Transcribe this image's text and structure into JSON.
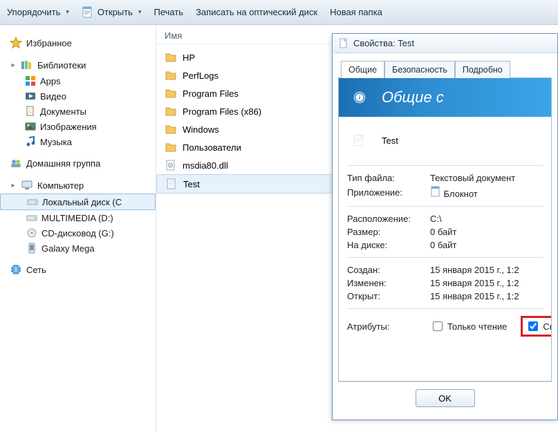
{
  "toolbar": {
    "organize": "Упорядочить",
    "open": "Открыть",
    "print": "Печать",
    "burn": "Записать на оптический диск",
    "newfolder": "Новая папка"
  },
  "sidebar": {
    "favorites": "Избранное",
    "libraries": "Библиотеки",
    "lib_items": [
      "Apps",
      "Видео",
      "Документы",
      "Изображения",
      "Музыка"
    ],
    "homegroup": "Домашняя группа",
    "computer": "Компьютер",
    "drives": [
      "Локальный диск (C",
      "MULTIMEDIA (D:)",
      "CD-дисковод (G:)",
      "Galaxy Mega"
    ],
    "network": "Сеть"
  },
  "filepane": {
    "header": "Имя",
    "items": [
      {
        "type": "folder",
        "name": "HP"
      },
      {
        "type": "folder",
        "name": "PerfLogs"
      },
      {
        "type": "folder",
        "name": "Program Files"
      },
      {
        "type": "folder",
        "name": "Program Files (x86)"
      },
      {
        "type": "folder",
        "name": "Windows"
      },
      {
        "type": "folder",
        "name": "Пользователи"
      },
      {
        "type": "dll",
        "name": "msdia80.dll"
      },
      {
        "type": "txt",
        "name": "Test",
        "selected": true
      }
    ]
  },
  "props": {
    "title": "Свойства: Test",
    "tabs": [
      "Общие",
      "Безопасность",
      "Подробно"
    ],
    "banner": "Общие с",
    "filename": "Test",
    "rows1": [
      {
        "k": "Тип файла:",
        "v": "Текстовый документ"
      },
      {
        "k": "Приложение:",
        "v": "Блокнот",
        "icon": "notepad"
      }
    ],
    "rows2": [
      {
        "k": "Расположение:",
        "v": "C:\\"
      },
      {
        "k": "Размер:",
        "v": "0 байт"
      },
      {
        "k": "На диске:",
        "v": "0 байт"
      }
    ],
    "rows3": [
      {
        "k": "Создан:",
        "v": "15 января 2015 г., 1:2"
      },
      {
        "k": "Изменен:",
        "v": "15 января 2015 г., 1:2"
      },
      {
        "k": "Открыт:",
        "v": "15 января 2015 г., 1:2"
      }
    ],
    "attrs_label": "Атрибуты:",
    "readonly": "Только чтение",
    "hidden": "Скр",
    "ok": "OK"
  }
}
